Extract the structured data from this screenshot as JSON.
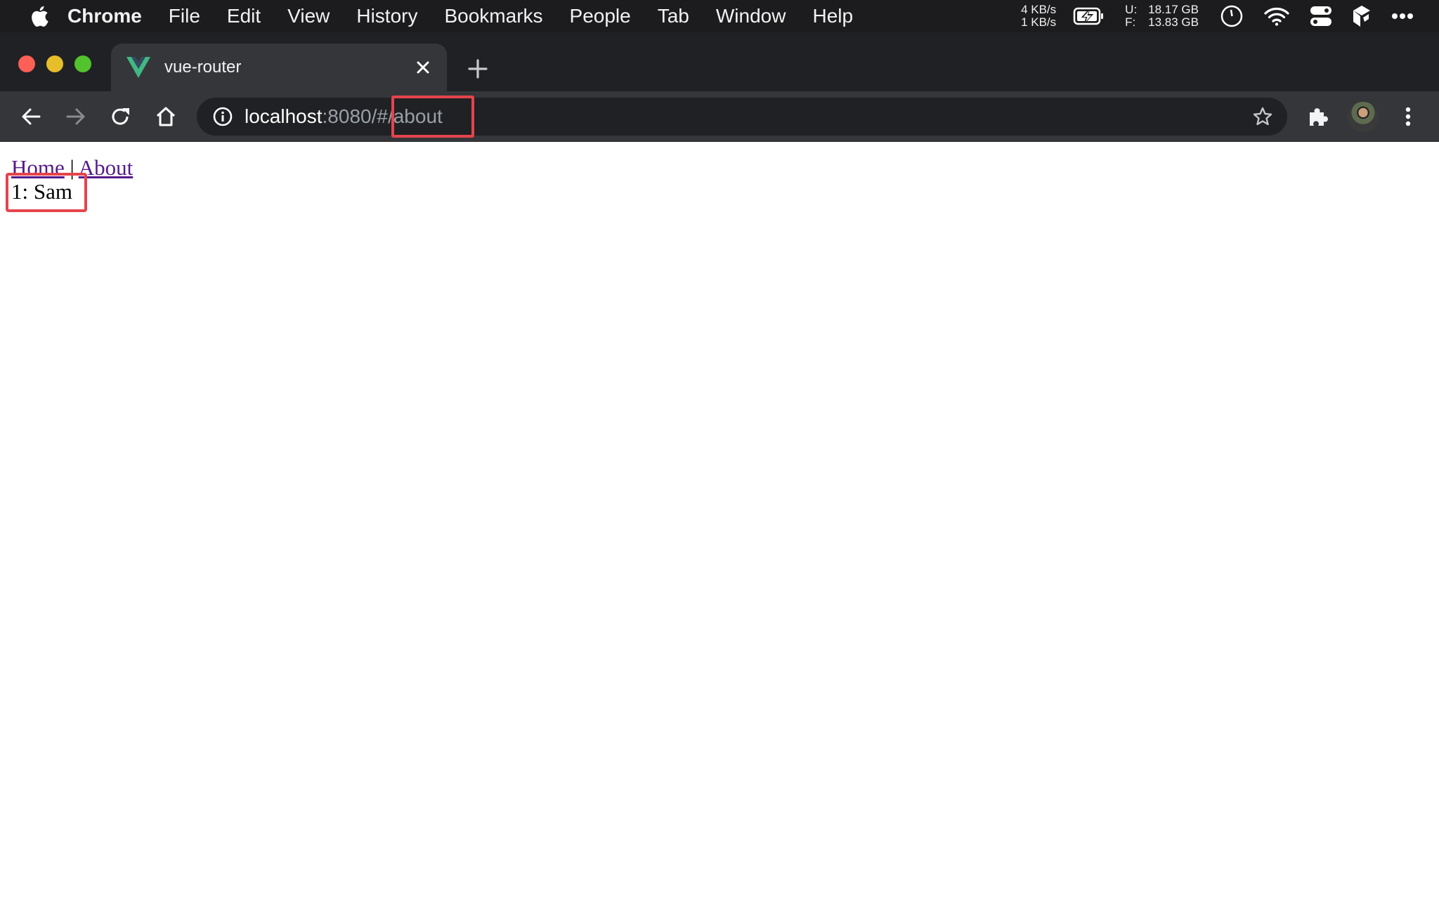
{
  "menubar": {
    "apple_icon": "apple-logo-icon",
    "app_name": "Chrome",
    "items": [
      "File",
      "Edit",
      "View",
      "History",
      "Bookmarks",
      "People",
      "Tab",
      "Window",
      "Help"
    ],
    "status": {
      "net_up": "4 KB/s",
      "net_down": "1 KB/s",
      "disk_used_label": "U:",
      "disk_used": "18.17 GB",
      "disk_free_label": "F:",
      "disk_free": "13.83 GB",
      "icons": [
        "battery-charging-icon",
        "clock-icon",
        "wifi-icon",
        "control-center-icon",
        "app-icon",
        "more-icon"
      ]
    }
  },
  "browser": {
    "tab": {
      "title": "vue-router",
      "favicon": "vue-logo-icon"
    },
    "address_bar": {
      "host": "localhost",
      "port_path": ":8080/",
      "hash": "#/about"
    },
    "colors": {
      "highlight": "#e5444c",
      "vue_green": "#41b883",
      "vue_dark": "#35495e",
      "link": "#551a8b"
    }
  },
  "page": {
    "nav": {
      "home": "Home",
      "separator": " | ",
      "about": "About"
    },
    "user_line": "1: Sam"
  }
}
